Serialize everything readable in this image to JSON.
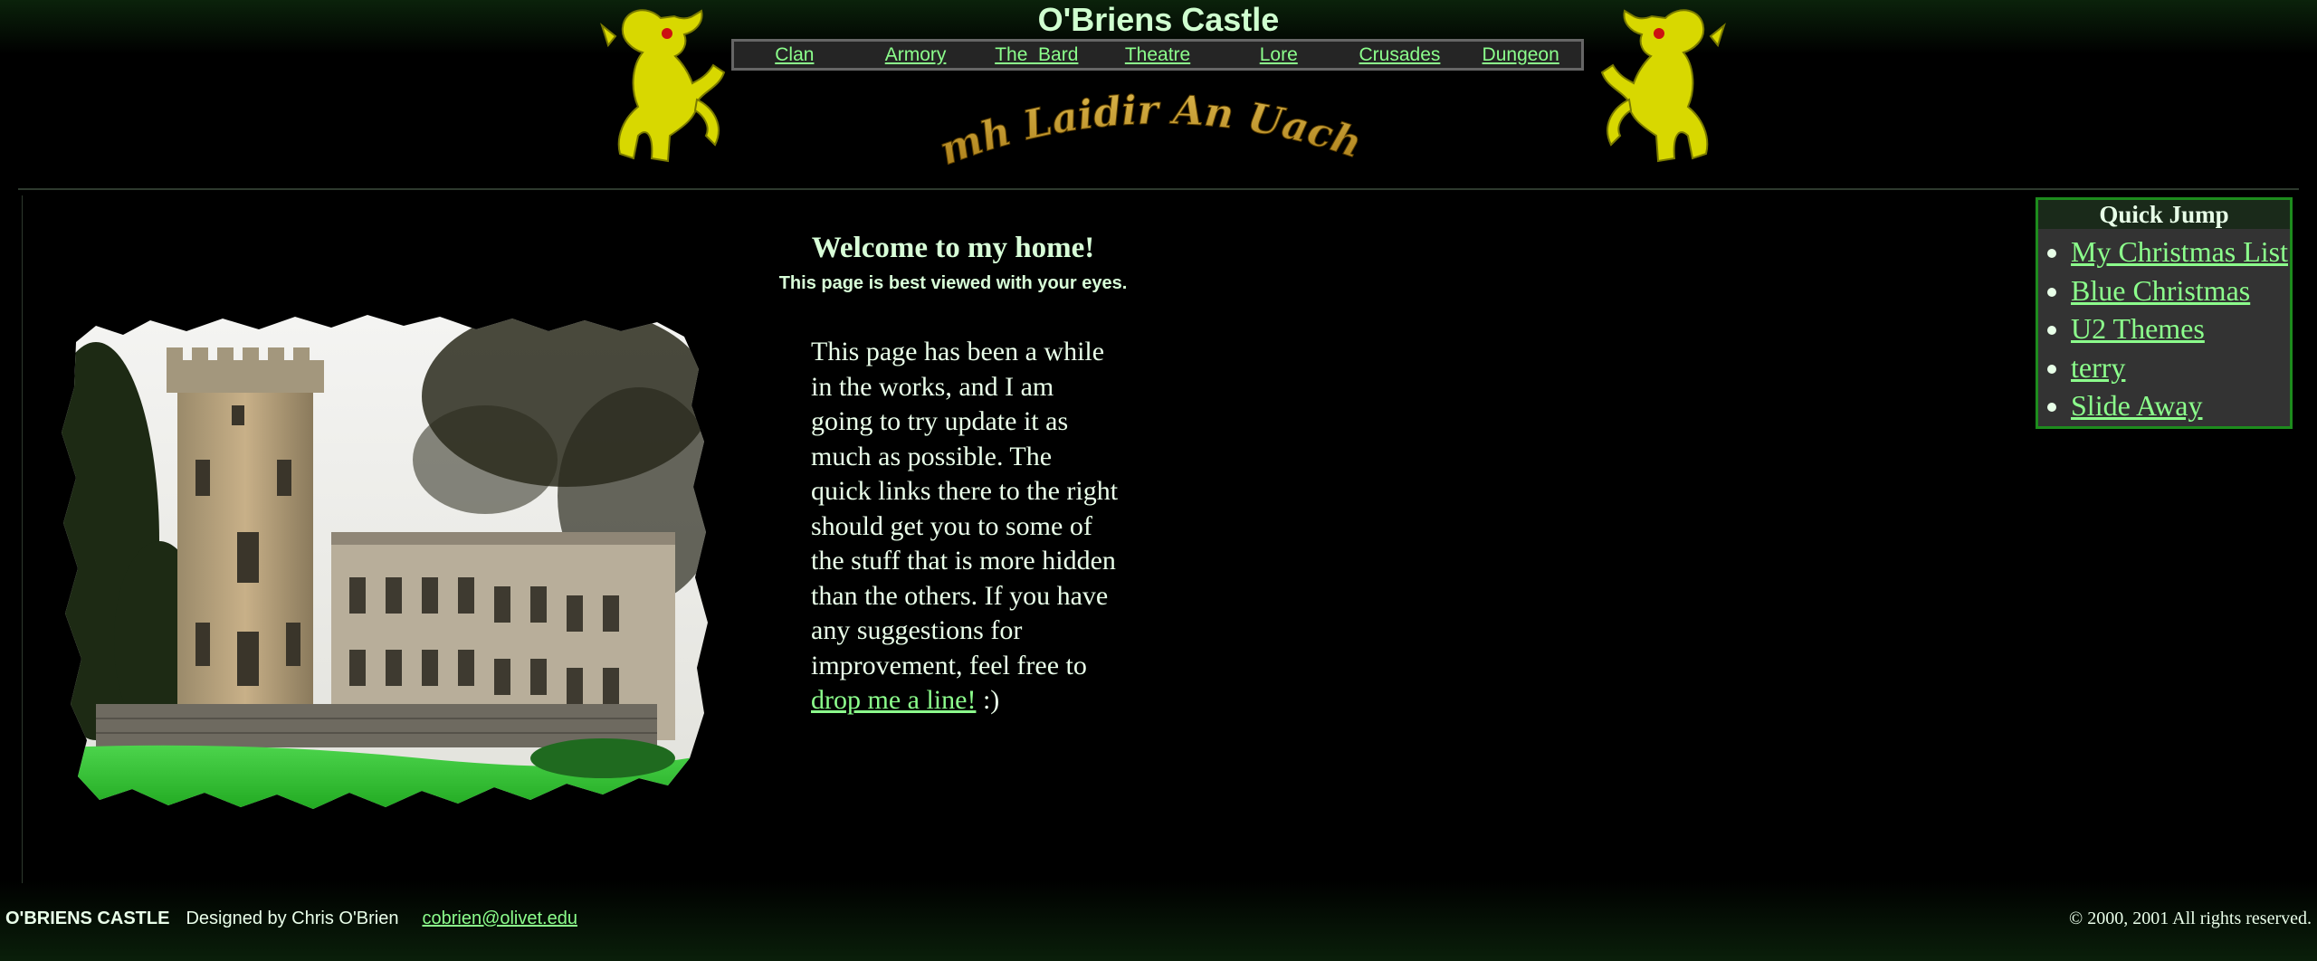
{
  "header": {
    "site_title": "O'Briens Castle",
    "motto": "Lamh Laidir An Uachdar",
    "nav": [
      {
        "label": "Clan"
      },
      {
        "label": "Armory"
      },
      {
        "label": "The  Bard"
      },
      {
        "label": "Theatre"
      },
      {
        "label": "Lore"
      },
      {
        "label": "Crusades"
      },
      {
        "label": "Dungeon"
      }
    ]
  },
  "main": {
    "welcome_heading": "Welcome to my home!",
    "tagline": "This page is best viewed with your eyes.",
    "intro_text": "This page has been a while in the works, and I am going to try update it as much as possible. The quick links there to the right should get you to some of the stuff that is more hidden than the others. If you have any suggestions for improvement, feel free to",
    "contact_link": "drop me a line!",
    "intro_suffix": " :)"
  },
  "quick_jump": {
    "title": "Quick Jump",
    "links": [
      {
        "label": "My Christmas List"
      },
      {
        "label": "Blue Christmas"
      },
      {
        "label": "U2 Themes"
      },
      {
        "label": "terry"
      },
      {
        "label": "Slide Away"
      }
    ]
  },
  "footer": {
    "brand": "O'BRIENS CASTLE",
    "designer": "Designed by Chris O'Brien",
    "email": "cobrien@olivet.edu",
    "copyright": "© 2000, 2001 All rights reserved."
  },
  "colors": {
    "background": "#000000",
    "link": "#8cff8c",
    "text": "#ddffdd",
    "lion": "#e8e800",
    "box_border": "#1d8c1d"
  }
}
